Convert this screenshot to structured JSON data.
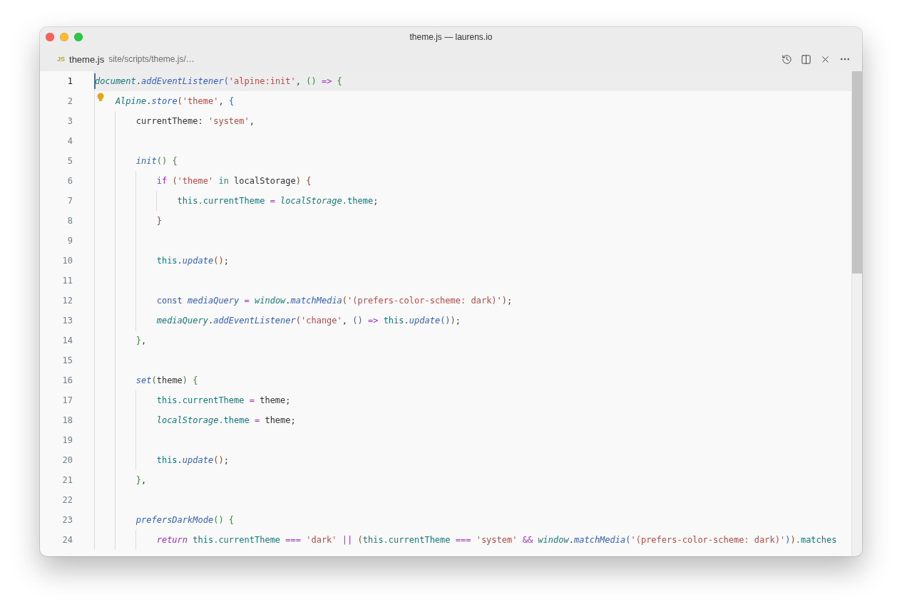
{
  "window": {
    "title": "theme.js — laurens.io"
  },
  "tab": {
    "badge": "JS",
    "filename": "theme.js",
    "path": "site/scripts/theme.js/…"
  },
  "editor": {
    "lines": [
      {
        "number": "1",
        "active": true,
        "lightbulb": false,
        "tokens": [
          {
            "kind": "global",
            "text": "document"
          },
          {
            "kind": "plain",
            "text": "."
          },
          {
            "kind": "fn",
            "text": "addEventListener"
          },
          {
            "kind": "b1",
            "text": "("
          },
          {
            "kind": "string",
            "text": "'alpine:init'"
          },
          {
            "kind": "plain",
            "text": ", "
          },
          {
            "kind": "b2",
            "text": "() "
          },
          {
            "kind": "keyword",
            "text": "=> "
          },
          {
            "kind": "b2",
            "text": "{"
          }
        ],
        "children": [
          {
            "number": "2",
            "active": false,
            "lightbulb": true,
            "tokens": [
              {
                "kind": "global",
                "text": "Alpine"
              },
              {
                "kind": "plain",
                "text": "."
              },
              {
                "kind": "fn",
                "text": "store"
              },
              {
                "kind": "b3",
                "text": "("
              },
              {
                "kind": "string",
                "text": "'theme'"
              },
              {
                "kind": "plain",
                "text": ", "
              },
              {
                "kind": "b1",
                "text": "{"
              }
            ],
            "children": [
              {
                "number": "3",
                "active": false,
                "lightbulb": false,
                "tokens": [
                  {
                    "kind": "plain",
                    "text": "currentTheme: "
                  },
                  {
                    "kind": "string",
                    "text": "'system'"
                  },
                  {
                    "kind": "plain",
                    "text": ","
                  }
                ]
              },
              {
                "number": "4",
                "active": false,
                "lightbulb": false
              },
              {
                "number": "5",
                "active": false,
                "lightbulb": false,
                "tokens": [
                  {
                    "kind": "fn",
                    "text": "init"
                  },
                  {
                    "kind": "b2",
                    "text": "() {"
                  }
                ],
                "children": [
                  {
                    "number": "6",
                    "active": false,
                    "lightbulb": false,
                    "tokens": [
                      {
                        "kind": "keyword",
                        "text": "if "
                      },
                      {
                        "kind": "b3",
                        "text": "("
                      },
                      {
                        "kind": "string",
                        "text": "'theme' "
                      },
                      {
                        "kind": "word-operator",
                        "text": "in "
                      },
                      {
                        "kind": "plain",
                        "text": "localStorage"
                      },
                      {
                        "kind": "b3",
                        "text": ") {"
                      }
                    ],
                    "children": [
                      {
                        "number": "7",
                        "active": false,
                        "lightbulb": false,
                        "tokens": [
                          {
                            "kind": "member",
                            "text": "this.currentTheme "
                          },
                          {
                            "kind": "keyword",
                            "text": "= "
                          },
                          {
                            "kind": "global",
                            "text": "localStorage"
                          },
                          {
                            "kind": "member",
                            "text": ".theme"
                          },
                          {
                            "kind": "plain",
                            "text": ";"
                          }
                        ]
                      }
                    ]
                  },
                  {
                    "number": "8",
                    "active": false,
                    "lightbulb": false,
                    "tokens": [
                      {
                        "kind": "b3",
                        "text": "}"
                      }
                    ]
                  },
                  {
                    "number": "9",
                    "active": false,
                    "lightbulb": false
                  },
                  {
                    "number": "10",
                    "active": false,
                    "lightbulb": false,
                    "tokens": [
                      {
                        "kind": "member",
                        "text": "this"
                      },
                      {
                        "kind": "plain",
                        "text": "."
                      },
                      {
                        "kind": "fn",
                        "text": "update"
                      },
                      {
                        "kind": "b3",
                        "text": "()"
                      },
                      {
                        "kind": "plain",
                        "text": ";"
                      }
                    ]
                  },
                  {
                    "number": "11",
                    "active": false,
                    "lightbulb": false
                  },
                  {
                    "number": "12",
                    "active": false,
                    "lightbulb": false,
                    "tokens": [
                      {
                        "kind": "storage",
                        "text": "const "
                      },
                      {
                        "kind": "fn",
                        "text": "mediaQuery "
                      },
                      {
                        "kind": "keyword",
                        "text": "= "
                      },
                      {
                        "kind": "global",
                        "text": "window"
                      },
                      {
                        "kind": "plain",
                        "text": "."
                      },
                      {
                        "kind": "fn",
                        "text": "matchMedia"
                      },
                      {
                        "kind": "b3",
                        "text": "("
                      },
                      {
                        "kind": "string",
                        "text": "'(prefers-color-scheme: dark)'"
                      },
                      {
                        "kind": "b3",
                        "text": ")"
                      },
                      {
                        "kind": "plain",
                        "text": ";"
                      }
                    ]
                  },
                  {
                    "number": "13",
                    "active": false,
                    "lightbulb": false,
                    "tokens": [
                      {
                        "kind": "global",
                        "text": "mediaQuery"
                      },
                      {
                        "kind": "plain",
                        "text": "."
                      },
                      {
                        "kind": "fn",
                        "text": "addEventListener"
                      },
                      {
                        "kind": "b3",
                        "text": "("
                      },
                      {
                        "kind": "string",
                        "text": "'change'"
                      },
                      {
                        "kind": "plain",
                        "text": ", "
                      },
                      {
                        "kind": "b1",
                        "text": "() "
                      },
                      {
                        "kind": "keyword",
                        "text": "=> "
                      },
                      {
                        "kind": "member",
                        "text": "this"
                      },
                      {
                        "kind": "plain",
                        "text": "."
                      },
                      {
                        "kind": "fn",
                        "text": "update"
                      },
                      {
                        "kind": "b1",
                        "text": "()"
                      },
                      {
                        "kind": "b3",
                        "text": ")"
                      },
                      {
                        "kind": "plain",
                        "text": ";"
                      }
                    ]
                  }
                ]
              },
              {
                "number": "14",
                "active": false,
                "lightbulb": false,
                "tokens": [
                  {
                    "kind": "b2",
                    "text": "}"
                  },
                  {
                    "kind": "plain",
                    "text": ","
                  }
                ]
              },
              {
                "number": "15",
                "active": false,
                "lightbulb": false
              },
              {
                "number": "16",
                "active": false,
                "lightbulb": false,
                "tokens": [
                  {
                    "kind": "fn",
                    "text": "set"
                  },
                  {
                    "kind": "b2",
                    "text": "("
                  },
                  {
                    "kind": "plain",
                    "text": "theme"
                  },
                  {
                    "kind": "b2",
                    "text": ") {"
                  }
                ],
                "children": [
                  {
                    "number": "17",
                    "active": false,
                    "lightbulb": false,
                    "tokens": [
                      {
                        "kind": "member",
                        "text": "this.currentTheme "
                      },
                      {
                        "kind": "keyword",
                        "text": "= "
                      },
                      {
                        "kind": "plain",
                        "text": "theme;"
                      }
                    ]
                  },
                  {
                    "number": "18",
                    "active": false,
                    "lightbulb": false,
                    "tokens": [
                      {
                        "kind": "global",
                        "text": "localStorage"
                      },
                      {
                        "kind": "member",
                        "text": ".theme "
                      },
                      {
                        "kind": "keyword",
                        "text": "= "
                      },
                      {
                        "kind": "plain",
                        "text": "theme;"
                      }
                    ]
                  },
                  {
                    "number": "19",
                    "active": false,
                    "lightbulb": false
                  },
                  {
                    "number": "20",
                    "active": false,
                    "lightbulb": false,
                    "tokens": [
                      {
                        "kind": "member",
                        "text": "this"
                      },
                      {
                        "kind": "plain",
                        "text": "."
                      },
                      {
                        "kind": "fn",
                        "text": "update"
                      },
                      {
                        "kind": "b3",
                        "text": "()"
                      },
                      {
                        "kind": "plain",
                        "text": ";"
                      }
                    ]
                  }
                ]
              },
              {
                "number": "21",
                "active": false,
                "lightbulb": false,
                "tokens": [
                  {
                    "kind": "b2",
                    "text": "}"
                  },
                  {
                    "kind": "plain",
                    "text": ","
                  }
                ]
              },
              {
                "number": "22",
                "active": false,
                "lightbulb": false
              },
              {
                "number": "23",
                "active": false,
                "lightbulb": false,
                "tokens": [
                  {
                    "kind": "fn",
                    "text": "prefersDarkMode"
                  },
                  {
                    "kind": "b2",
                    "text": "() {"
                  }
                ],
                "children": [
                  {
                    "number": "24",
                    "active": false,
                    "lightbulb": false,
                    "tokens": [
                      {
                        "kind": "keyword-italic",
                        "text": "return "
                      },
                      {
                        "kind": "member",
                        "text": "this.currentTheme "
                      },
                      {
                        "kind": "keyword",
                        "text": "=== "
                      },
                      {
                        "kind": "string",
                        "text": "'dark' "
                      },
                      {
                        "kind": "keyword",
                        "text": "|| "
                      },
                      {
                        "kind": "b3",
                        "text": "("
                      },
                      {
                        "kind": "member",
                        "text": "this.currentTheme "
                      },
                      {
                        "kind": "keyword",
                        "text": "=== "
                      },
                      {
                        "kind": "string",
                        "text": "'system' "
                      },
                      {
                        "kind": "keyword",
                        "text": "&& "
                      },
                      {
                        "kind": "global",
                        "text": "window"
                      },
                      {
                        "kind": "plain",
                        "text": "."
                      },
                      {
                        "kind": "fn",
                        "text": "matchMedia"
                      },
                      {
                        "kind": "b1",
                        "text": "("
                      },
                      {
                        "kind": "string",
                        "text": "'(prefers-color-scheme: dark)'"
                      },
                      {
                        "kind": "b1",
                        "text": ")"
                      },
                      {
                        "kind": "b3",
                        "text": ")"
                      },
                      {
                        "kind": "member",
                        "text": ".matches"
                      }
                    ]
                  }
                ]
              }
            ]
          }
        ]
      }
    ]
  }
}
